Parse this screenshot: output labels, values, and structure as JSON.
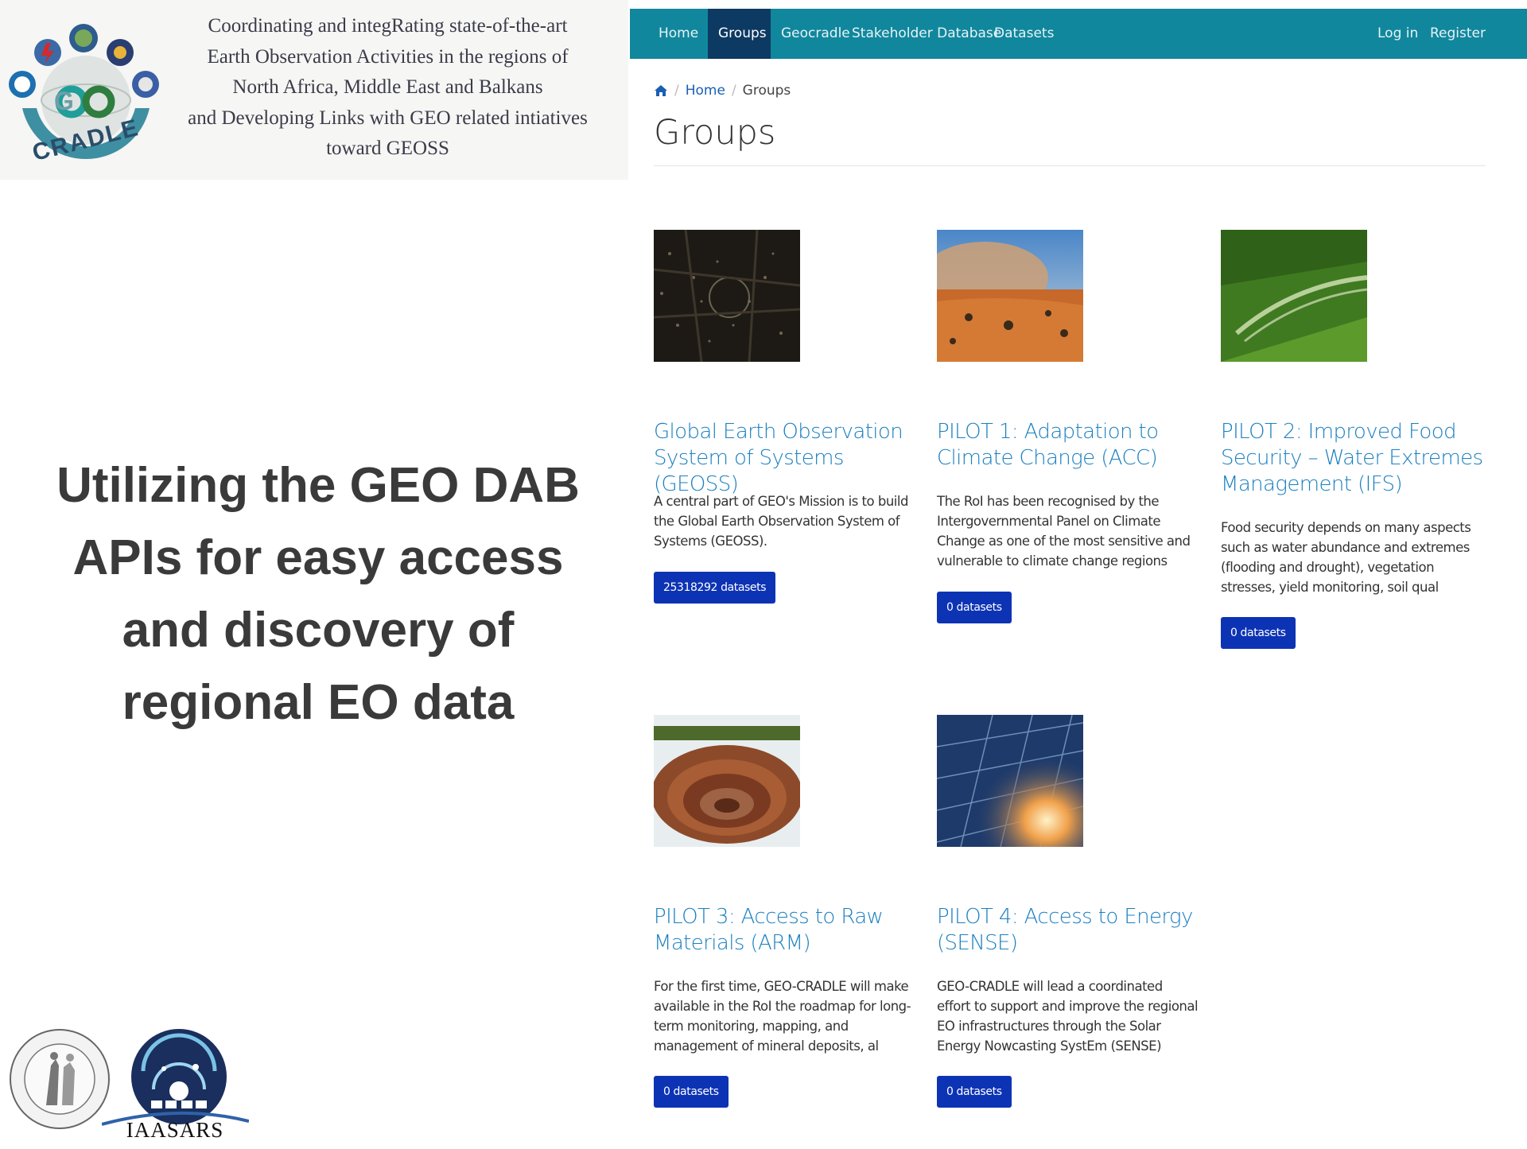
{
  "banner": {
    "lines": [
      "Coordinating and integRating state-of-the-art",
      "Earth Observation Activities in the regions of",
      "North Africa, Middle East and Balkans",
      "and Developing Links with GEO related intiatives",
      "toward GEOSS"
    ],
    "logo_text": "CRADLE"
  },
  "slide": {
    "title_lines": [
      "Utilizing the GEO DAB",
      "APIs for easy access",
      "and discovery of",
      "regional EO data"
    ]
  },
  "logos": {
    "iaasars": "IAASARS"
  },
  "navbar": {
    "items": [
      "Home",
      "Groups",
      "Geocradle",
      "Stakeholder Database",
      "Datasets"
    ],
    "active": "Groups",
    "login": "Log in",
    "register": "Register",
    "color": "#11879d",
    "active_color": "#0d3a63"
  },
  "breadcrumb": {
    "home": "Home",
    "current": "Groups"
  },
  "page_title": "Groups",
  "groups": [
    {
      "title": "Global Earth Observation System of Systems (GEOSS)",
      "description": "A central part of GEO's Mission is to build the Global Earth Observation System of Systems (GEOSS).",
      "button": "25318292 datasets",
      "image": "city-lights-night-image"
    },
    {
      "title": "PILOT 1: Adaptation to Climate Change (ACC)",
      "description": "The RoI has been recognised by the Intergovernmental Panel on Climate Change as one of the most sensitive and vulnerable to climate change regions",
      "button": "0 datasets",
      "image": "desert-sandstorm-image"
    },
    {
      "title": "PILOT 2: Improved Food Security – Water Extremes Management (IFS)",
      "description": "Food security depends on many aspects such as water abundance and extremes (flooding and drought), vegetation stresses, yield monitoring, soil qual",
      "button": "0 datasets",
      "image": "crop-irrigation-image"
    },
    {
      "title": "PILOT 3: Access to Raw Materials (ARM)",
      "description": "For the first time, GEO-CRADLE will make available in the RoI the roadmap for long-term monitoring, mapping, and management of mineral deposits, al",
      "button": "0 datasets",
      "image": "open-pit-mine-image"
    },
    {
      "title": "PILOT 4: Access to Energy (SENSE)",
      "description": "GEO-CRADLE will lead a coordinated effort to support and improve the regional EO infrastructures through the Solar Energy Nowcasting SystEm (SENSE)",
      "button": "0 datasets",
      "image": "solar-panel-image"
    }
  ]
}
